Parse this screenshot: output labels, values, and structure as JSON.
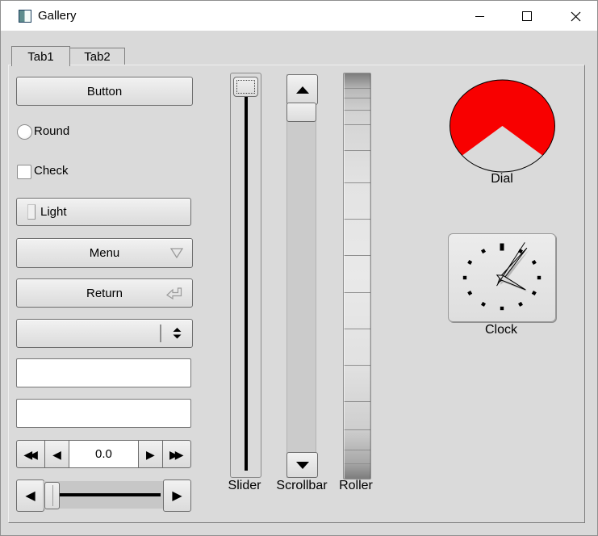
{
  "titlebar": {
    "title": "Gallery"
  },
  "tabs": {
    "tab1": "Tab1",
    "tab2": "Tab2"
  },
  "widgets": {
    "button_label": "Button",
    "round_label": "Round",
    "check_label": "Check",
    "light_label": "Light",
    "menu_label": "Menu",
    "return_label": "Return",
    "counter_value": "0.0",
    "slider_caption": "Slider",
    "scrollbar_caption": "Scrollbar",
    "roller_caption": "Roller",
    "dial_caption": "Dial",
    "clock_caption": "Clock"
  },
  "icons": {
    "counter_fast_left": "◀◀",
    "counter_left": "◀",
    "counter_right": "▶",
    "counter_fast_right": "▶▶",
    "hslider_left": "◀",
    "hslider_right": "▶"
  },
  "states": {
    "round_checked": false,
    "check_checked": false,
    "light_on": false,
    "dial_color": "#f80000",
    "dial_unfilled_wedge_deg": [
      220,
      320
    ],
    "clock_hand_angles_deg": {
      "hour": 117,
      "minute": 40,
      "second": 33
    }
  }
}
